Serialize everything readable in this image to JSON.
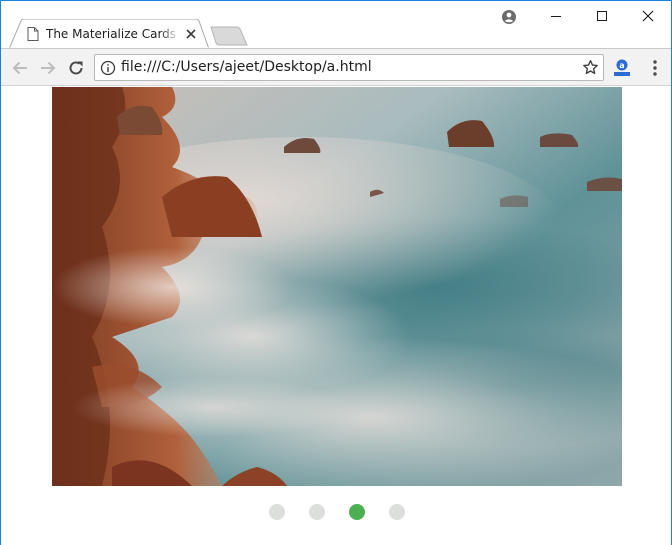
{
  "window": {
    "tab_title": "The Materialize Cards Example",
    "controls": [
      "minimize",
      "maximize",
      "close"
    ]
  },
  "toolbar": {
    "url": "file:///C:/Users/ajeet/Desktop/a.html"
  },
  "carousel": {
    "slide_count": 4,
    "active_index": 2,
    "colors": {
      "active_dot": "#4caf50",
      "inactive_dot": "#dcdedc"
    }
  },
  "colors": {
    "window_border": "#1883d7",
    "toolbar_bg": "#f2f2f2",
    "icon": "#5a5a5a"
  }
}
